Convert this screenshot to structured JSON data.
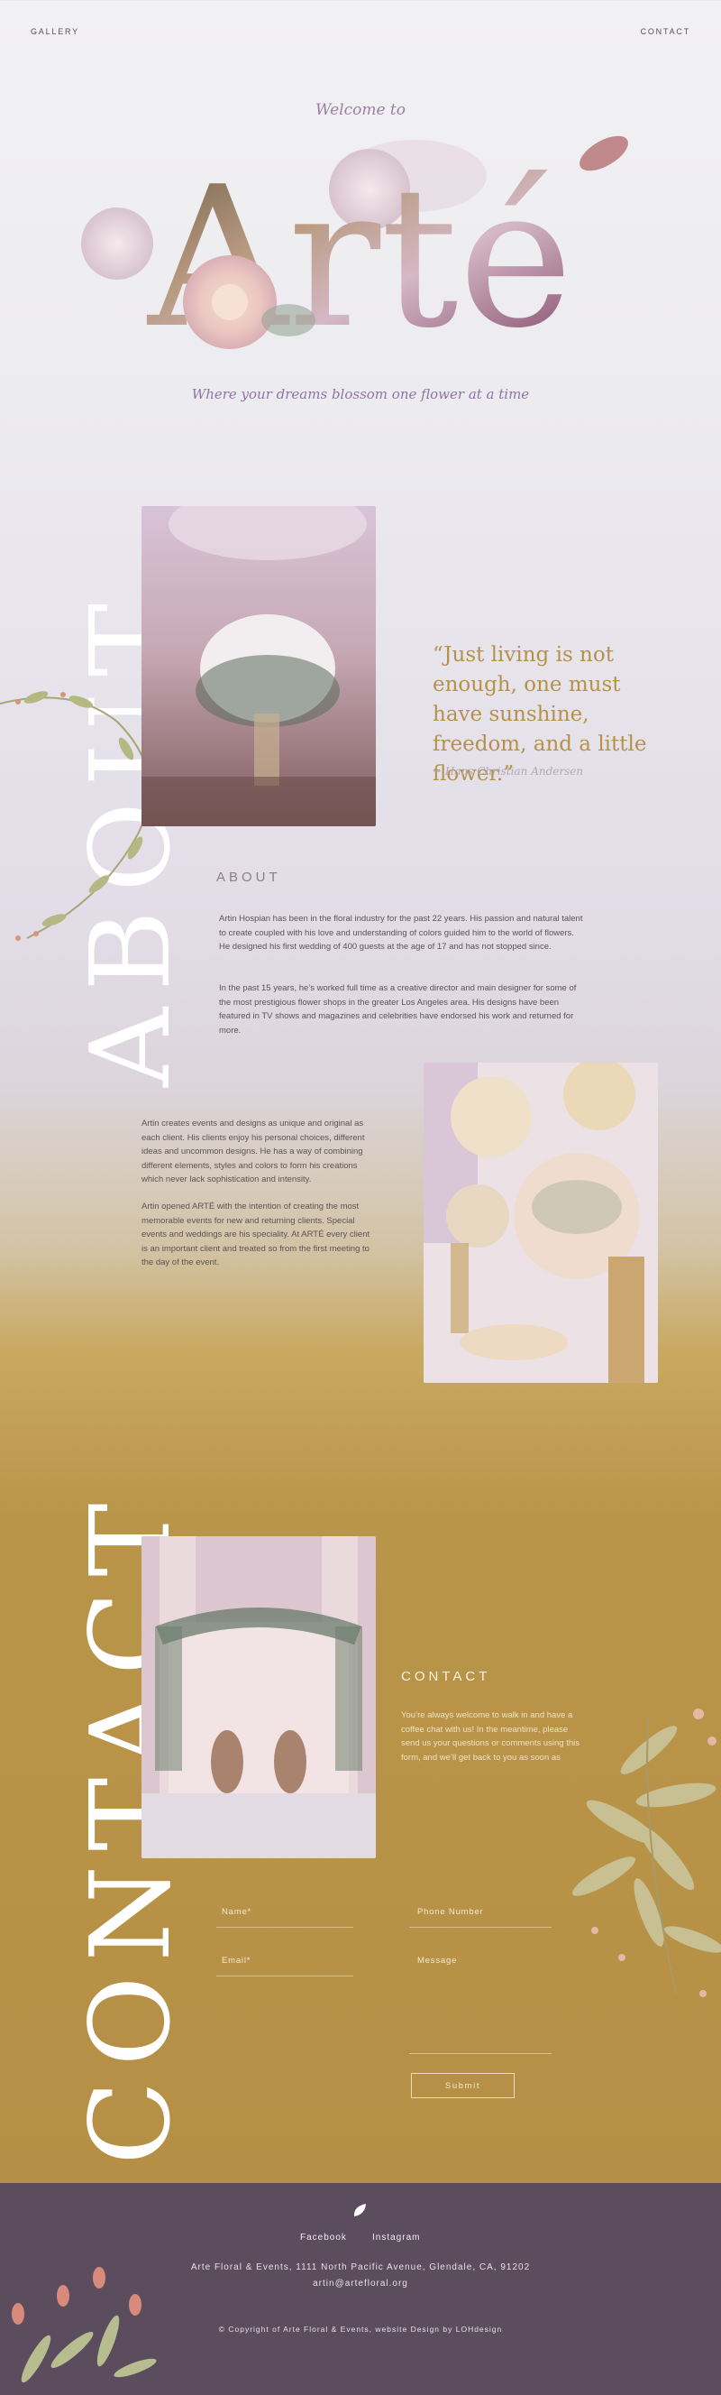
{
  "nav": {
    "gallery": "GALLERY",
    "contact": "CONTACT"
  },
  "hero": {
    "welcome": "Welcome to",
    "title": "Arté",
    "tagline": "Where your dreams blossom one flower at a time"
  },
  "quote": {
    "text": "“Just living is not enough, one must have sunshine, freedom, and a little flower.”",
    "author": "~ Hans Christian Andersen"
  },
  "about": {
    "vertical_title": "ABOUT",
    "label": "ABOUT",
    "p1": "Artin Hospian has been in the floral industry for the past 22 years. His passion and natural talent to create coupled with his love and understanding of colors guided him to the world of flowers. He designed his first wedding of 400 guests at the age of 17 and has not stopped since.",
    "p2": "In the past 15 years, he’s worked full time as a creative director and main designer for some of the most prestigious flower shops in the greater Los Angeles area. His designs have been featured in TV shows and magazines and celebrities have endorsed his work and returned for more.",
    "p3": "Artin creates events and designs as unique and original as each client. His clients enjoy his personal choices, different ideas and uncommon designs. He has a way of combining different elements, styles and colors to form his creations which never lack sophistication and intensity.",
    "p4": "Artin opened ARTÉ with the intention of creating the most memorable events for new and returning clients. Special events and weddings are his speciality. At ARTÉ every client is an important client and treated so from the first meeting to the day of the event."
  },
  "contact": {
    "vertical_title": "CONTACT",
    "label": "CONTACT",
    "text": "You’re always welcome to walk in and have a coffee chat with us! In the meantime, please send us your questions or comments using this form, and we’ll get back to you as soon as",
    "name_label": "Name*",
    "phone_label": "Phone Number",
    "email_label": "Email*",
    "message_label": "Message",
    "submit": "Submit"
  },
  "footer": {
    "facebook": "Facebook",
    "instagram": "Instagram",
    "address": "Arte Floral & Events, 1111 North Pacific Avenue, Glendale, CA, 91202",
    "email": "artin@artefloral.org",
    "copyright": "© Copyright of Arte Floral & Events, website Design by LOHdesign"
  },
  "colors": {
    "accent_gold": "#b6914a",
    "lavender": "#9b7fa4",
    "footer_bg": "#5b4d5e"
  },
  "icons": [
    "leaf-logo-icon"
  ]
}
